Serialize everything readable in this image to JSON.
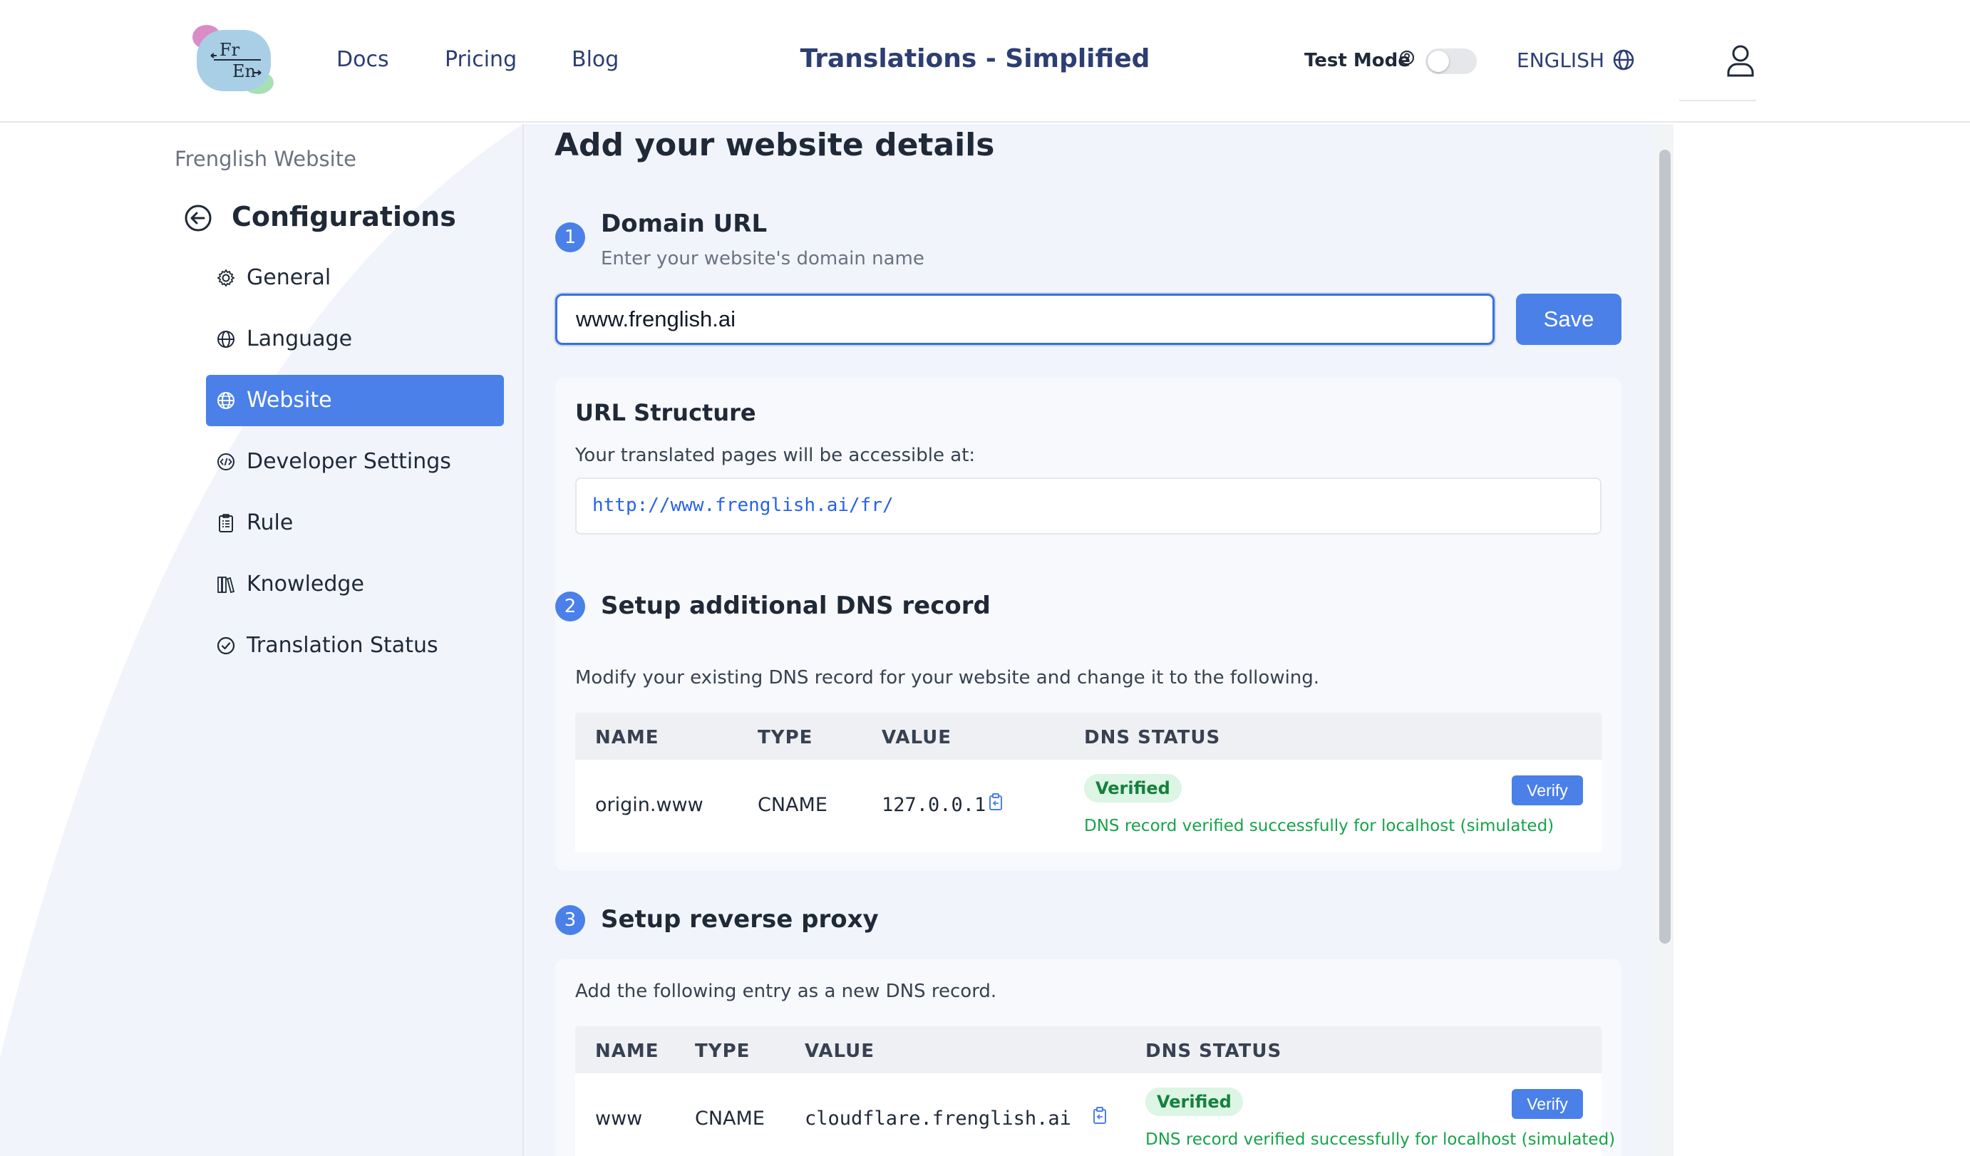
{
  "header": {
    "logo_text_top": "Fr",
    "logo_text_bottom": "En",
    "nav": [
      "Docs",
      "Pricing",
      "Blog"
    ],
    "title": "Translations - Simplified",
    "test_mode_label": "Test Mode",
    "test_mode_on": false,
    "language": "ENGLISH"
  },
  "sidebar": {
    "subtitle": "Frenglish Website",
    "title": "Configurations",
    "items": [
      {
        "label": "General",
        "icon": "gear-icon",
        "active": false
      },
      {
        "label": "Language",
        "icon": "globe-icon",
        "active": false
      },
      {
        "label": "Website",
        "icon": "globe-icon",
        "active": true
      },
      {
        "label": "Developer Settings",
        "icon": "code-icon",
        "active": false
      },
      {
        "label": "Rule",
        "icon": "clipboard-list-icon",
        "active": false
      },
      {
        "label": "Knowledge",
        "icon": "books-icon",
        "active": false
      },
      {
        "label": "Translation Status",
        "icon": "check-circle-icon",
        "active": false
      }
    ]
  },
  "main": {
    "heading": "Add your website details",
    "step1": {
      "number": "1",
      "title": "Domain URL",
      "description": "Enter your website's domain name",
      "input_value": "www.frenglish.ai",
      "save_label": "Save"
    },
    "url_structure": {
      "title": "URL Structure",
      "description": "Your translated pages will be accessible at:",
      "url": "http://www.frenglish.ai/fr/"
    },
    "step2": {
      "number": "2",
      "title": "Setup additional DNS record",
      "description": "Modify your existing DNS record for your website and change it to the following.",
      "columns": [
        "NAME",
        "TYPE",
        "VALUE",
        "DNS STATUS"
      ],
      "row": {
        "name": "origin.www",
        "type": "CNAME",
        "value": "127.0.0.1",
        "status": "Verified",
        "status_message": "DNS record verified successfully for localhost (simulated)",
        "verify_label": "Verify"
      }
    },
    "step3": {
      "number": "3",
      "title": "Setup reverse proxy",
      "description": "Add the following entry as a new DNS record.",
      "columns": [
        "NAME",
        "TYPE",
        "VALUE",
        "DNS STATUS"
      ],
      "row": {
        "name": "www",
        "type": "CNAME",
        "value": "cloudflare.frenglish.ai",
        "status": "Verified",
        "status_message": "DNS record verified successfully for localhost (simulated)",
        "verify_label": "Verify"
      }
    }
  },
  "colors": {
    "accent": "#4a80e8",
    "nav_text": "#2c3e72",
    "main_bg": "#f1f5fb",
    "success": "#16a34a"
  }
}
